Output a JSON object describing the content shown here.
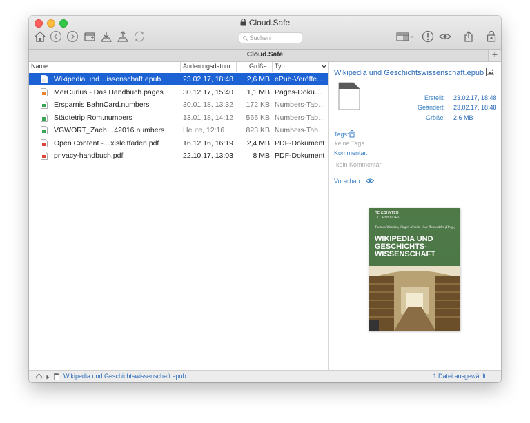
{
  "window": {
    "title": "Cloud.Safe"
  },
  "toolbar": {
    "icons": [
      "home-icon",
      "back-icon",
      "forward-icon",
      "new-window-icon",
      "download-icon",
      "upload-icon",
      "sync-icon",
      "view-options-icon",
      "info-icon",
      "quicklook-icon",
      "share-icon",
      "safe-icon"
    ]
  },
  "search": {
    "placeholder": "Suchen"
  },
  "tabbar": {
    "title": "Cloud.Safe",
    "add_label": "+"
  },
  "columns": {
    "name": "Name",
    "date": "Änderungsdatum",
    "size": "Größe",
    "type": "Typ"
  },
  "files": [
    {
      "name": "Wikipedia und…issenschaft.epub",
      "date": "23.02.17, 18:48",
      "size": "2,6 MB",
      "type": "ePub-Veröffe…",
      "icon": "epub-file-icon",
      "color": "#e9e9e9"
    },
    {
      "name": "MerCurius - Das Handbuch.pages",
      "date": "30.12.17, 15:40",
      "size": "1,1 MB",
      "type": "Pages-Doku…",
      "icon": "pages-file-icon",
      "color": "#e8842c"
    },
    {
      "name": "Ersparnis BahnCard.numbers",
      "date": "30.01.18, 13:32",
      "size": "172 KB",
      "type": "Numbers-Tab…",
      "icon": "numbers-file-icon",
      "color": "#3aa655"
    },
    {
      "name": "Städtetrip Rom.numbers",
      "date": "13.01.18, 14:12",
      "size": "566 KB",
      "type": "Numbers-Tab…",
      "icon": "numbers-file-icon",
      "color": "#3aa655"
    },
    {
      "name": "VGWORT_Zaeh…42016.numbers",
      "date": "Heute, 12:16",
      "size": "823 KB",
      "type": "Numbers-Tab…",
      "icon": "numbers-file-icon",
      "color": "#3aa655"
    },
    {
      "name": "Open Content -…xisleitfaden.pdf",
      "date": "16.12.16, 16:19",
      "size": "2,4 MB",
      "type": "PDF-Dokument",
      "icon": "pdf-file-icon",
      "color": "#d9483b"
    },
    {
      "name": "privacy-handbuch.pdf",
      "date": "22.10.17, 13:03",
      "size": "8 MB",
      "type": "PDF-Dokument",
      "icon": "pdf-file-icon",
      "color": "#d9483b"
    }
  ],
  "info": {
    "title": "Wikipedia und Geschichtswissenschaft.epub",
    "created_label": "Erstellt:",
    "created": "23.02.17, 18:48",
    "modified_label": "Geändert:",
    "modified": "23.02.17, 18:48",
    "size_label": "Größe:",
    "size": "2,6 MB",
    "tags_label": "Tags:",
    "tags": "keine Tags",
    "comment_label": "Kommentar:",
    "comment": "kein Kommentar",
    "preview_label": "Vorschau:"
  },
  "cover": {
    "publisher": "DE GRUYTER",
    "publisher_sub": "OLDENBOURG",
    "authors": "Thomas Wozniak, Jürgen Nemitz, Uwe Rohwedder (Hrsg.)",
    "title": "WIKIPEDIA UND GESCHICHTS-WISSENSCHAFT"
  },
  "statusbar": {
    "path_file": "Wikipedia und Geschichtswissenschaft.epub",
    "selection": "1 Datei ausgewählt"
  },
  "accent": "#1c62d5"
}
